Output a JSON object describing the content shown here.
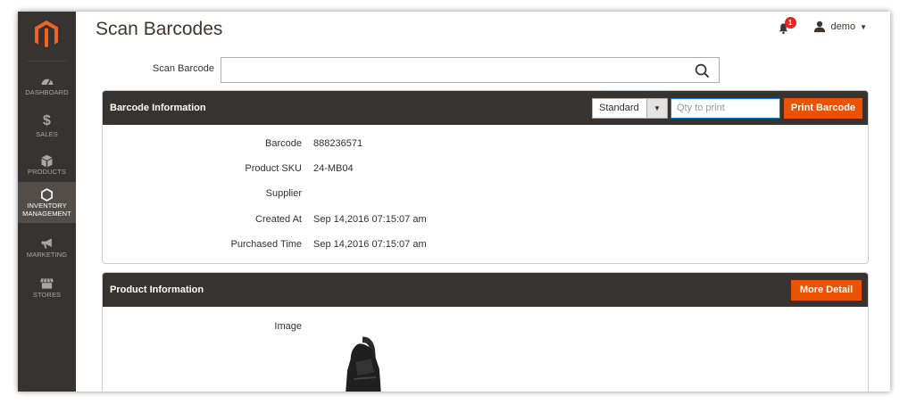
{
  "sidebar": {
    "items": [
      {
        "label": "Dashboard",
        "icon": "gauge-icon"
      },
      {
        "label": "Sales",
        "icon": "dollar-icon"
      },
      {
        "label": "Products",
        "icon": "box-icon"
      },
      {
        "label": "Inventory Management",
        "line1": "INVENTORY",
        "line2": "MANAGEMENT",
        "icon": "hexagon-icon",
        "active": true
      },
      {
        "label": "Marketing",
        "icon": "megaphone-icon"
      },
      {
        "label": "Stores",
        "icon": "store-icon"
      }
    ]
  },
  "header": {
    "title": "Scan Barcodes",
    "notification_count": "1",
    "user_name": "demo"
  },
  "scan": {
    "label": "Scan Barcode",
    "value": ""
  },
  "barcode_info": {
    "title": "Barcode Information",
    "type_select": "Standard",
    "qty_placeholder": "Qty to print",
    "print_button": "Print Barcode",
    "fields": [
      {
        "label": "Barcode",
        "value": "888236571"
      },
      {
        "label": "Product SKU",
        "value": "24-MB04"
      },
      {
        "label": "Supplier",
        "value": ""
      },
      {
        "label": "Created At",
        "value": "Sep 14,2016 07:15:07 am"
      },
      {
        "label": "Purchased Time",
        "value": "Sep 14,2016 07:15:07 am"
      }
    ]
  },
  "product_info": {
    "title": "Product Information",
    "more_button": "More Detail",
    "image_label": "Image"
  },
  "colors": {
    "sidebar_bg": "#373330",
    "accent": "#eb5202",
    "badge": "#e22626"
  }
}
